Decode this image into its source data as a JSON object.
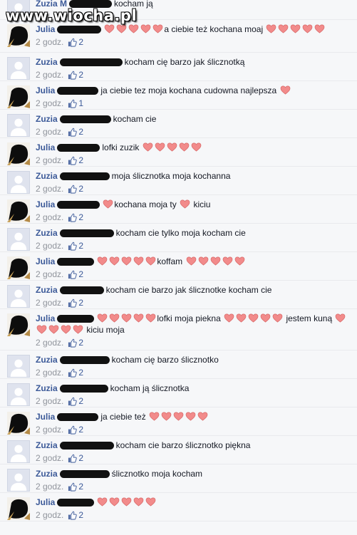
{
  "watermark": "www.wiocha.pl",
  "comments": [
    {
      "author": "Zuzia M",
      "text": "kocham ją",
      "hearts_before": 0,
      "text2": "",
      "hearts_after": 0,
      "time": "",
      "likes": ""
    },
    {
      "author": "Julia",
      "text": "a ciebie też",
      "hearts_before": 5,
      "text2": "kochana moaj",
      "hearts_after": 5,
      "time": "2 godz.",
      "likes": "2"
    },
    {
      "author": "Zuzia",
      "text": "kocham cię barzo jak ślicznotką",
      "hearts_before": 0,
      "text2": "",
      "hearts_after": 0,
      "time": "2 godz.",
      "likes": "2"
    },
    {
      "author": "Julia",
      "text": "ja ciebie tez moja kochana cudowna najlepsza",
      "hearts_before": 0,
      "text2": "",
      "hearts_after": 1,
      "time": "2 godz.",
      "likes": "1"
    },
    {
      "author": "Zuzia",
      "text": "kocham cie",
      "hearts_before": 0,
      "text2": "",
      "hearts_after": 0,
      "time": "2 godz.",
      "likes": "2"
    },
    {
      "author": "Julia",
      "text": "lofki zuzik",
      "hearts_before": 0,
      "text2": "",
      "hearts_after": 5,
      "time": "2 godz.",
      "likes": "2"
    },
    {
      "author": "Zuzia",
      "text": "moja ślicznotka moja kochanna",
      "hearts_before": 0,
      "text2": "",
      "hearts_after": 0,
      "time": "2 godz.",
      "likes": "2"
    },
    {
      "author": "Julia",
      "text": "kochana",
      "hearts_before": 1,
      "text2": "moja ty",
      "hearts_after": 1,
      "text3": "kiciu",
      "time": "2 godz.",
      "likes": "2"
    },
    {
      "author": "Zuzia",
      "text": "kocham cie tylko moja kocham cie",
      "hearts_before": 0,
      "text2": "",
      "hearts_after": 0,
      "time": "2 godz.",
      "likes": "2"
    },
    {
      "author": "Julia",
      "text": "",
      "hearts_before": 5,
      "text2": "koffam",
      "hearts_after": 5,
      "time": "2 godz.",
      "likes": "2"
    },
    {
      "author": "Zuzia",
      "text": "kocham cie barzo jak ślicznotke kocham cie",
      "hearts_before": 0,
      "text2": "",
      "hearts_after": 0,
      "time": "2 godz.",
      "likes": "2"
    },
    {
      "author": "Julia",
      "text": "",
      "hearts_before": 5,
      "text2": "lofki moja piekna",
      "hearts_after": 5,
      "text3": "jestem kuną",
      "hearts_after2": 5,
      "text4": "kiciu moja",
      "time": "2 godz.",
      "likes": "2"
    },
    {
      "author": "Zuzia",
      "text": "kocham cię barzo ślicznotko",
      "hearts_before": 0,
      "text2": "",
      "hearts_after": 0,
      "time": "2 godz.",
      "likes": "2"
    },
    {
      "author": "Zuzia",
      "text": "kocham ją ślicznotka",
      "hearts_before": 0,
      "text2": "",
      "hearts_after": 0,
      "time": "2 godz.",
      "likes": "2"
    },
    {
      "author": "Julia",
      "text": "ja ciebie też",
      "hearts_before": 0,
      "text2": "",
      "hearts_after": 5,
      "time": "2 godz.",
      "likes": "2"
    },
    {
      "author": "Zuzia",
      "text": "kocham cie barzo ślicznotko piękna",
      "hearts_before": 0,
      "text2": "",
      "hearts_after": 0,
      "time": "2 godz.",
      "likes": "2"
    },
    {
      "author": "Zuzia",
      "text": "ślicznotko moja kocham",
      "hearts_before": 0,
      "text2": "",
      "hearts_after": 0,
      "time": "2 godz.",
      "likes": "2"
    },
    {
      "author": "Julia",
      "text": "",
      "hearts_before": 5,
      "text2": "",
      "hearts_after": 0,
      "time": "2 godz.",
      "likes": "2"
    }
  ],
  "colors": {
    "link": "#3b5998",
    "meta": "#90949c",
    "heart": "#f28b8b"
  }
}
